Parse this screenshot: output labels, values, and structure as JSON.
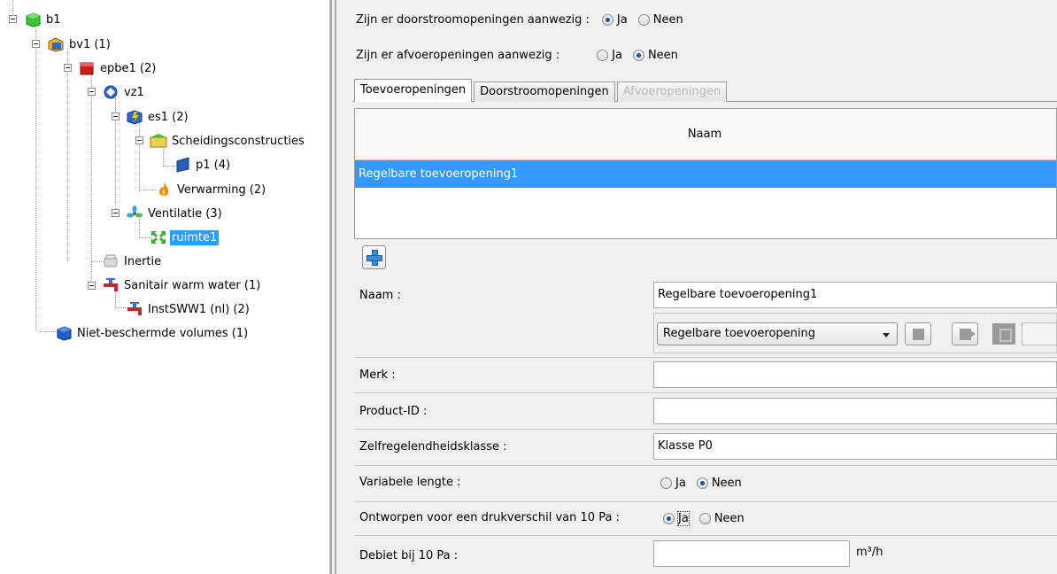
{
  "tree": {
    "nodes": [
      {
        "id": "b1",
        "label": "b1"
      },
      {
        "id": "bv1",
        "label": "bv1 (1)"
      },
      {
        "id": "epbe1",
        "label": "epbe1 (2)"
      },
      {
        "id": "vz1",
        "label": "vz1"
      },
      {
        "id": "es1",
        "label": "es1 (2)"
      },
      {
        "id": "scheiding",
        "label": "Scheidingsconstructies"
      },
      {
        "id": "p1",
        "label": "p1 (4)"
      },
      {
        "id": "verwarming",
        "label": "Verwarming (2)"
      },
      {
        "id": "ventilatie",
        "label": "Ventilatie (3)"
      },
      {
        "id": "ruimte1",
        "label": "ruimte1",
        "selected": true
      },
      {
        "id": "inertie",
        "label": "Inertie"
      },
      {
        "id": "sww",
        "label": "Sanitair warm water (1)"
      },
      {
        "id": "instsww1",
        "label": "InstSWW1 (nl) (2)"
      },
      {
        "id": "nietbeschermd",
        "label": "Niet-beschermde volumes (1)"
      }
    ]
  },
  "questions": {
    "doorstroom": {
      "label": "Zijn er doorstroomopeningen aanwezig :",
      "yes": "Ja",
      "no": "Neen",
      "selected": "Ja"
    },
    "afvoer": {
      "label": "Zijn er afvoeropeningen aanwezig :",
      "yes": "Ja",
      "no": "Neen",
      "selected": "Neen"
    }
  },
  "tabs": [
    {
      "label": "Toevoeropeningen",
      "state": "active"
    },
    {
      "label": "Doorstroomopeningen",
      "state": "normal"
    },
    {
      "label": "Afvoeropeningen",
      "state": "disabled"
    }
  ],
  "table": {
    "column": "Naam",
    "rows": [
      "Regelbare toevoeropening1"
    ]
  },
  "form": {
    "naam_label": "Naam :",
    "naam_value": "Regelbare toevoeropening1",
    "type_value": "Regelbare toevoeropening",
    "merk_label": "Merk :",
    "merk_value": "",
    "product_label": "Product-ID :",
    "product_value": "",
    "klasse_label": "Zelfregelendheidsklasse :",
    "klasse_value": "Klasse P0",
    "variabele_label": "Variabele lengte :",
    "variabele_yes": "Ja",
    "variabele_no": "Neen",
    "variabele_selected": "Neen",
    "drukverschil_label": "Ontworpen voor een drukverschil van 10 Pa :",
    "drukverschil_yes": "Ja",
    "drukverschil_no": "Neen",
    "drukverschil_selected": "Ja",
    "debiet_label": "Debiet bij 10 Pa :",
    "debiet_value": "",
    "debiet_unit": "m³/h"
  },
  "icons": {
    "b1": "green-cube-icon",
    "bv1": "building-icon",
    "epbe1": "red-cube-icon",
    "vz1": "zone-icon",
    "es1": "energy-sector-icon",
    "scheiding": "construction-icon",
    "p1": "panel-icon",
    "verwarming": "flame-icon",
    "ventilatie": "fan-icon",
    "ruimte1": "room-icon",
    "inertie": "inertia-icon",
    "sww": "tap-icon",
    "nietbeschermd": "blue-cube-icon"
  },
  "colors": {
    "selection": "#3399ff",
    "accent": "#2452a0"
  }
}
